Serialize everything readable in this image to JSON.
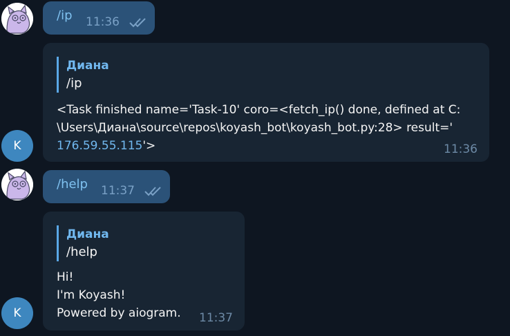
{
  "messages": [
    {
      "id": "m1",
      "direction": "out",
      "text": "/ip",
      "time": "11:36",
      "status": "read"
    },
    {
      "id": "m2",
      "direction": "in",
      "avatar_letter": "K",
      "reply_to": {
        "name": "Диана",
        "text": "/ip"
      },
      "body_line1": "<Task finished name='Task-10' coro=<fetch_ip() done, defined at C:",
      "body_line2": "\\Users\\Диана\\source\\repos\\koyash_bot\\koyash_bot.py:28> result='",
      "body_link": "176.59.55.115",
      "body_tail": "'>",
      "time": "11:36"
    },
    {
      "id": "m3",
      "direction": "out",
      "text": "/help",
      "time": "11:37",
      "status": "read"
    },
    {
      "id": "m4",
      "direction": "in",
      "avatar_letter": "K",
      "reply_to": {
        "name": "Диана",
        "text": "/help"
      },
      "body_lines": [
        "Hi!",
        "I'm Koyash!",
        "Powered by aiogram."
      ],
      "time": "11:37"
    }
  ],
  "colors": {
    "background": "#0e1621",
    "outgoing_bubble": "#2b5278",
    "incoming_bubble": "#182533",
    "accent": "#71b8ef",
    "bot_avatar": "#3e87bf"
  },
  "icons": {
    "user_avatar": "cat-doodle-avatar",
    "read_status": "double-check-icon"
  }
}
